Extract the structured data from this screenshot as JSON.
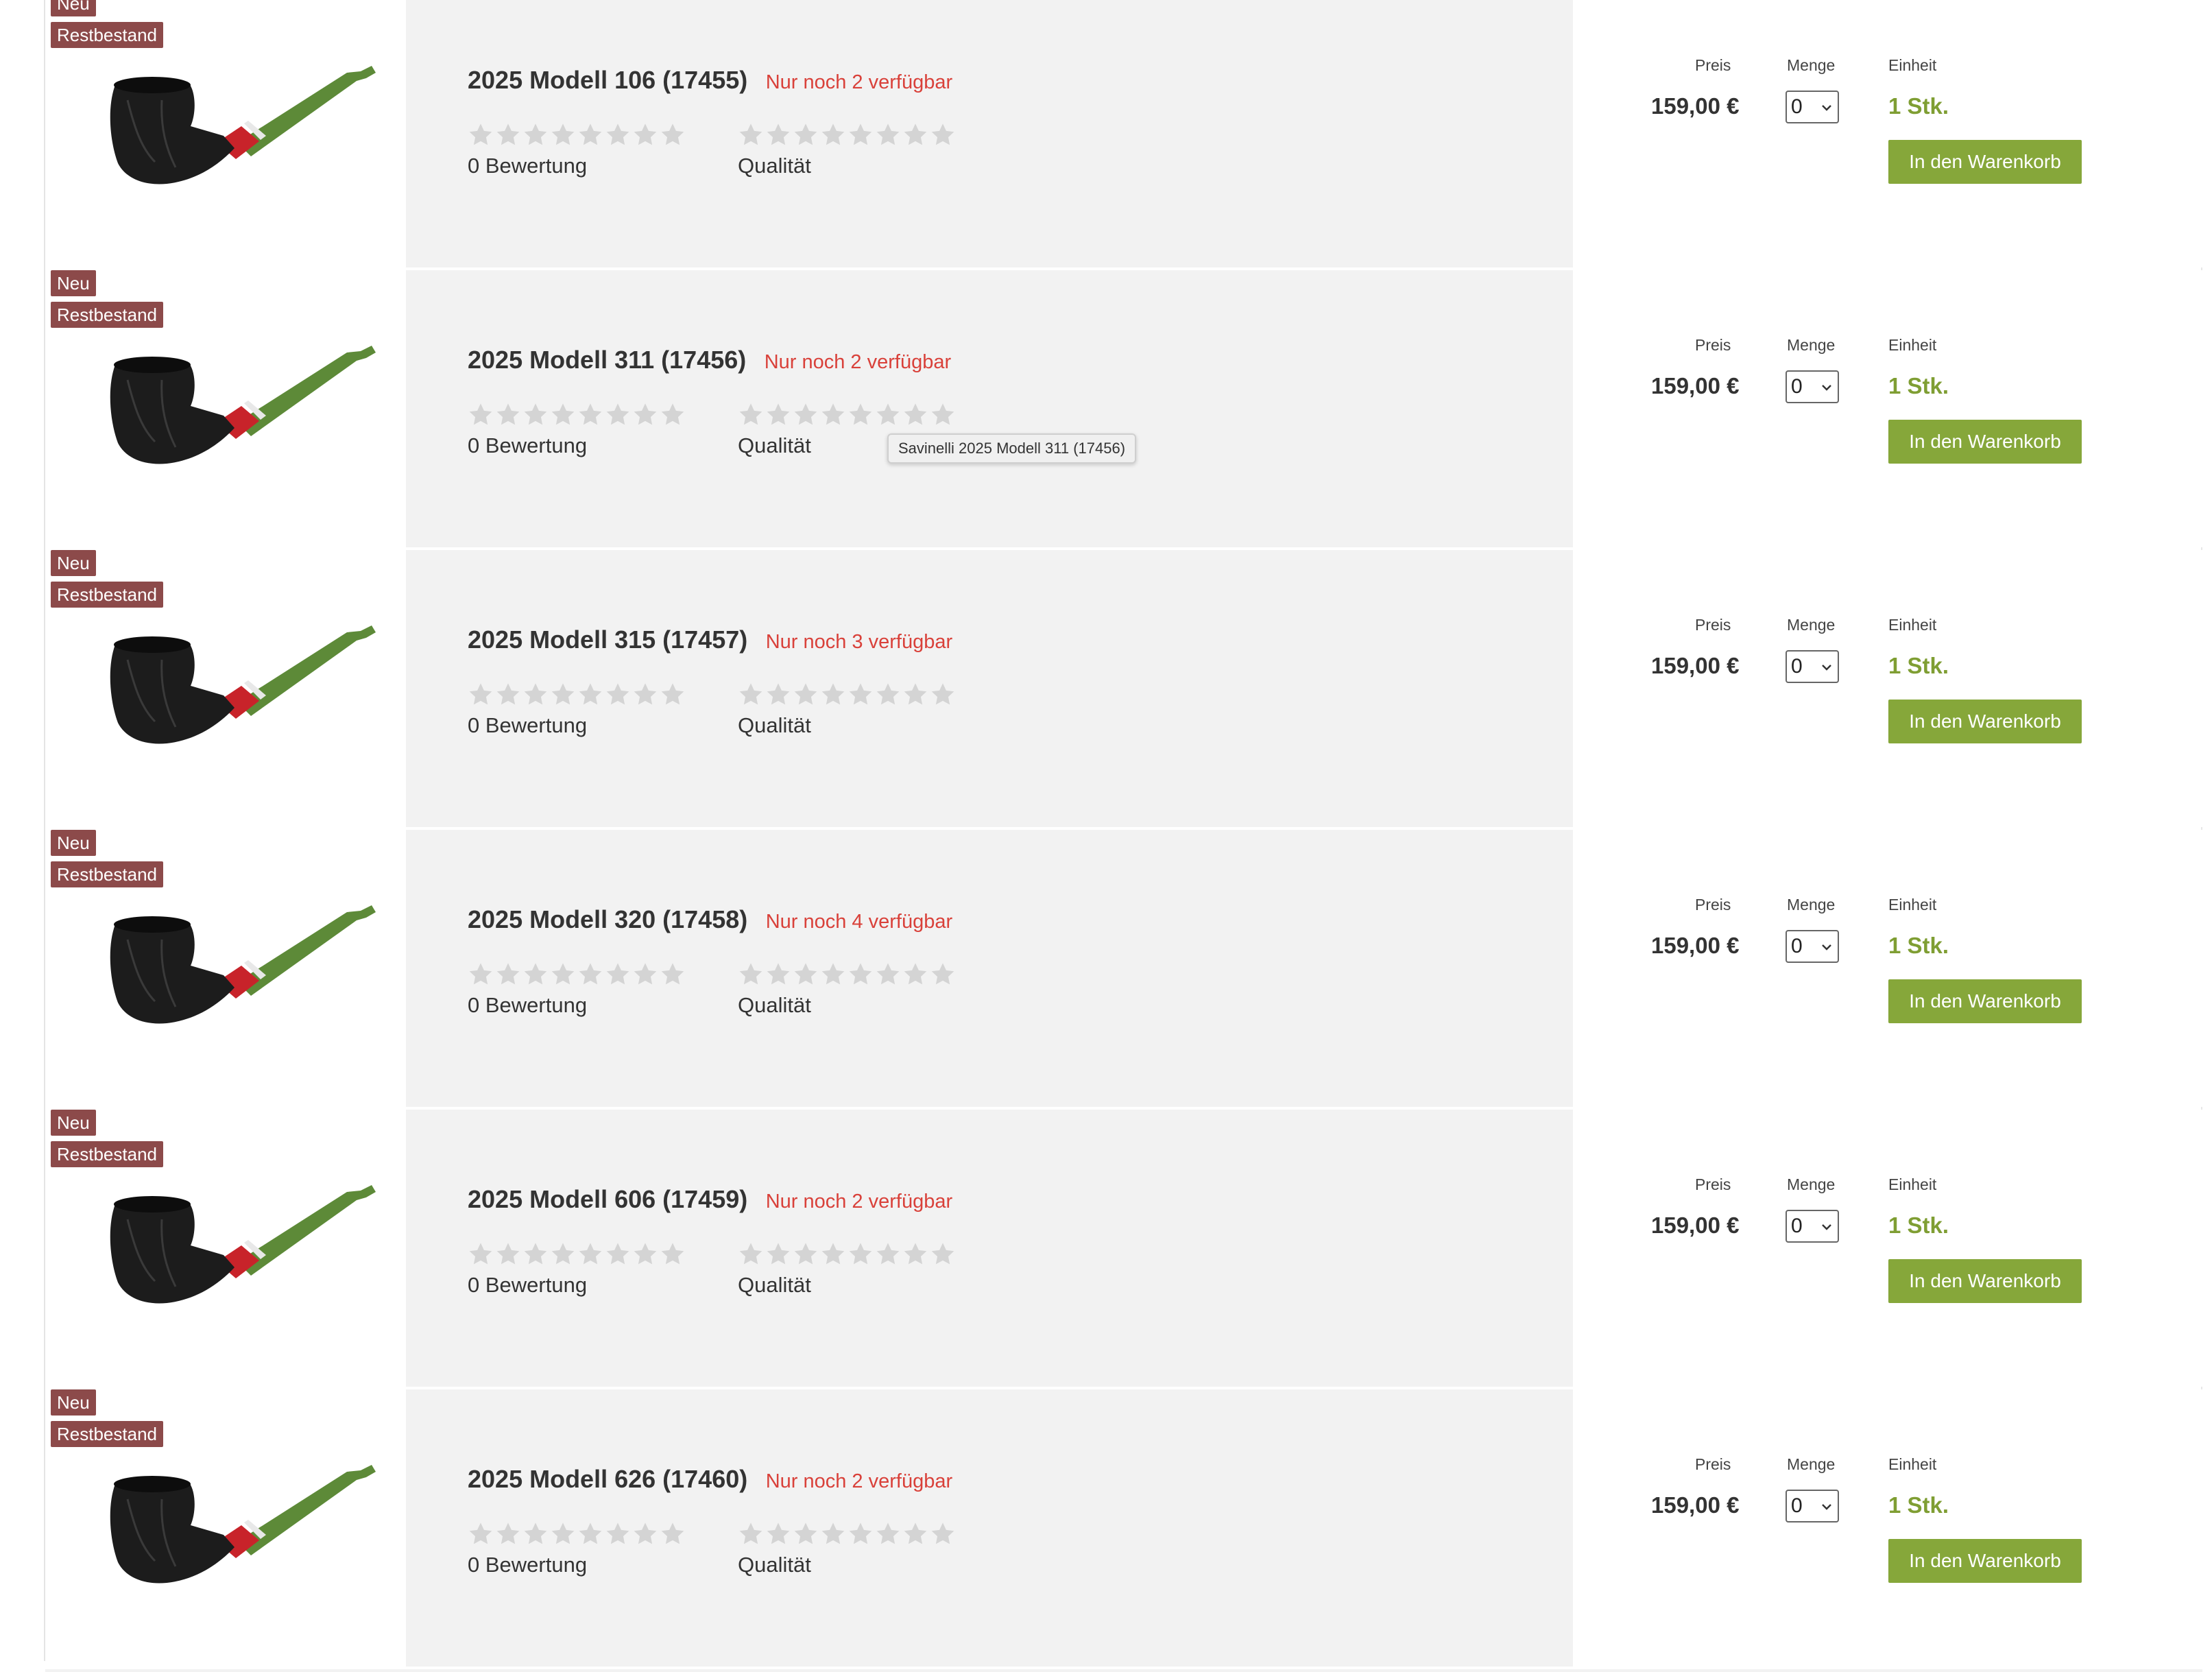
{
  "labels": {
    "neu": "Neu",
    "restbestand": "Restbestand",
    "bewertung": "0 Bewertung",
    "qualitaet": "Qualität",
    "preis": "Preis",
    "menge": "Menge",
    "einheit": "Einheit",
    "cart_button": "In den Warenkorb"
  },
  "colors": {
    "badge": "#8c4a4a",
    "stock_text": "#d9413a",
    "unit_text": "#7f9e33",
    "cart_button": "#86a73a",
    "star_empty": "#d4d4d4",
    "info_background": "#f2f2f2",
    "pipe_stem": "#5d8a38",
    "pipe_band": "#c8232a",
    "pipe_bowl": "#1c1c1c"
  },
  "tooltip": "Savinelli 2025 Modell 311 (17456)",
  "products": [
    {
      "title": "2025 Modell 106 (17455)",
      "stock": "Nur noch 2 verfügbar",
      "price": "159,00 €",
      "quantity": "0",
      "unit": "1  Stk.",
      "rating_stars": 0,
      "quality_stars": 0,
      "max_stars": 8,
      "image_icon": "pipe-icon"
    },
    {
      "title": "2025 Modell 311 (17456)",
      "stock": "Nur noch 2 verfügbar",
      "price": "159,00 €",
      "quantity": "0",
      "unit": "1  Stk.",
      "rating_stars": 0,
      "quality_stars": 0,
      "max_stars": 8,
      "image_icon": "pipe-icon"
    },
    {
      "title": "2025 Modell 315 (17457)",
      "stock": "Nur noch 3 verfügbar",
      "price": "159,00 €",
      "quantity": "0",
      "unit": "1  Stk.",
      "rating_stars": 0,
      "quality_stars": 0,
      "max_stars": 8,
      "image_icon": "pipe-icon"
    },
    {
      "title": "2025 Modell 320 (17458)",
      "stock": "Nur noch 4 verfügbar",
      "price": "159,00 €",
      "quantity": "0",
      "unit": "1  Stk.",
      "rating_stars": 0,
      "quality_stars": 0,
      "max_stars": 8,
      "image_icon": "pipe-icon"
    },
    {
      "title": "2025 Modell 606 (17459)",
      "stock": "Nur noch 2 verfügbar",
      "price": "159,00 €",
      "quantity": "0",
      "unit": "1  Stk.",
      "rating_stars": 0,
      "quality_stars": 0,
      "max_stars": 8,
      "image_icon": "pipe-icon"
    },
    {
      "title": "2025 Modell 626 (17460)",
      "stock": "Nur noch 2 verfügbar",
      "price": "159,00 €",
      "quantity": "0",
      "unit": "1  Stk.",
      "rating_stars": 0,
      "quality_stars": 0,
      "max_stars": 8,
      "image_icon": "pipe-icon"
    }
  ]
}
